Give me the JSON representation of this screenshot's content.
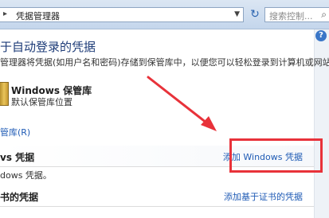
{
  "address_bar": {
    "path": "凭据管理器",
    "search_placeholder": "搜索控制..."
  },
  "title": "于自动登录的凭据",
  "description": "管理器将凭据(如用户名和密码)存储到保管库中，以便您可以轻松登录到计算机或网站。",
  "vault": {
    "name": "Windows 保管库",
    "location_label": "默认保管库位置"
  },
  "backup_link": "管库(R)",
  "windows_credentials": {
    "title": "vs 凭据",
    "add_link": "添加 Windows 凭据",
    "empty_text": "dows 凭据。"
  },
  "certificate_credentials": {
    "title": "书的凭据",
    "add_link": "添加基于证书的凭据"
  },
  "help_icon": "?",
  "annotation": {
    "box_color": "#e8323a",
    "arrow_color": "#e8323a"
  }
}
